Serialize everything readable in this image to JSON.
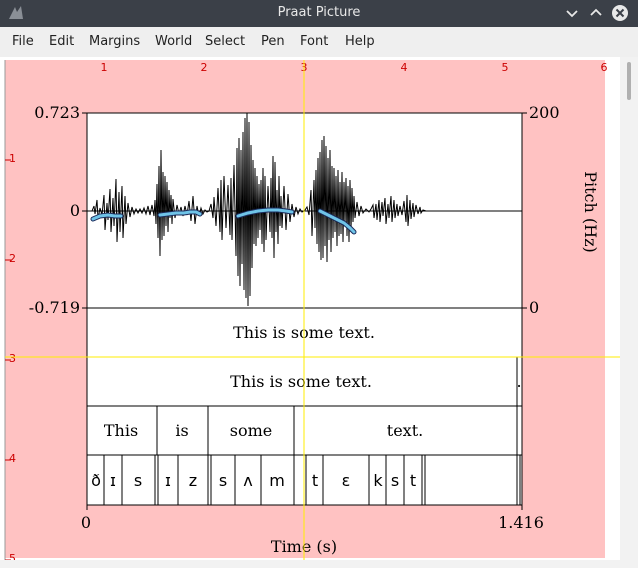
{
  "window": {
    "title": "Praat Picture",
    "buttons": [
      "minimize",
      "maximize",
      "close"
    ]
  },
  "menu": [
    "File",
    "Edit",
    "Margins",
    "World",
    "Select",
    "Pen",
    "Font",
    "Help"
  ],
  "ruler": {
    "top_ticks": [
      "1",
      "2",
      "3",
      "4",
      "5",
      "6"
    ],
    "left_ticks": [
      "1",
      "2",
      "3",
      "4",
      "5"
    ]
  },
  "plot": {
    "y_left_max": "0.723",
    "y_left_zero": "0",
    "y_left_min": "-0.719",
    "y_right_max": "200",
    "y_right_min": "0",
    "right_label": "Pitch (Hz)",
    "x_start": "0",
    "x_end": "1.416",
    "x_label": "Time (s)"
  },
  "tiers": {
    "tier1": "This is some text.",
    "tier2": "This is some text.",
    "tier2_extra": ".",
    "words": [
      "This",
      "is",
      "some",
      "text."
    ],
    "phones": [
      "ð",
      "ɪ",
      "s",
      "ɪ",
      "z",
      "s",
      "ʌ",
      "m",
      "t",
      "ɛ",
      "k",
      "s",
      "t"
    ]
  },
  "colors": {
    "paper": "#ffc2c2",
    "pitch": "#6fc4e8",
    "selection": "#ffee00",
    "ruler": "#cc0000",
    "titlebar": "#3b4048"
  }
}
